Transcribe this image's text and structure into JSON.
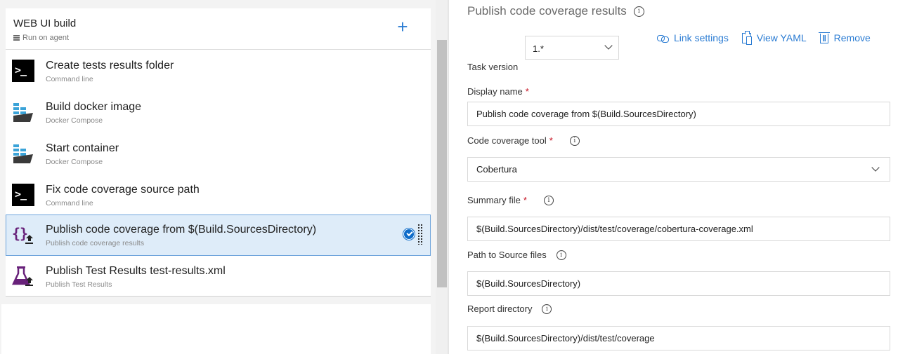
{
  "phase": {
    "title": "WEB UI build",
    "subtitle": "Run on agent",
    "add_label": "+"
  },
  "tasks": [
    {
      "name": "Create tests results folder",
      "type": "Command line",
      "icon": "command-line-icon"
    },
    {
      "name": "Build docker image",
      "type": "Docker Compose",
      "icon": "docker-icon"
    },
    {
      "name": "Start container",
      "type": "Docker Compose",
      "icon": "docker-icon"
    },
    {
      "name": "Fix code coverage source path",
      "type": "Command line",
      "icon": "command-line-icon"
    },
    {
      "name": "Publish code coverage from $(Build.SourcesDirectory)",
      "type": "Publish code coverage results",
      "icon": "publish-code-coverage-icon",
      "selected": true
    },
    {
      "name": "Publish Test Results test-results.xml",
      "type": "Publish Test Results",
      "icon": "publish-test-results-icon"
    }
  ],
  "details": {
    "title": "Publish code coverage results",
    "task_version_label": "Task version",
    "task_version_value": "1.*",
    "actions": {
      "link_settings": "Link settings",
      "view_yaml": "View YAML",
      "remove": "Remove"
    },
    "fields": {
      "display_name": {
        "label": "Display name",
        "required": "*",
        "value": "Publish code coverage from $(Build.SourcesDirectory)"
      },
      "coverage_tool": {
        "label": "Code coverage tool",
        "required": "*",
        "value": "Cobertura"
      },
      "summary_file": {
        "label": "Summary file",
        "required": "*",
        "value": "$(Build.SourcesDirectory)/dist/test/coverage/cobertura-coverage.xml"
      },
      "path_to_source": {
        "label": "Path to Source files",
        "value": "$(Build.SourcesDirectory)"
      },
      "report_directory": {
        "label": "Report directory",
        "value": "$(Build.SourcesDirectory)/dist/test/coverage"
      }
    },
    "info_glyph": "i"
  },
  "colors": {
    "accent": "#2b7cd3",
    "selected_bg": "#deecf9",
    "required": "#c50f1f",
    "docker_blue": "#3aa3d8",
    "publish_purple": "#68217a"
  }
}
